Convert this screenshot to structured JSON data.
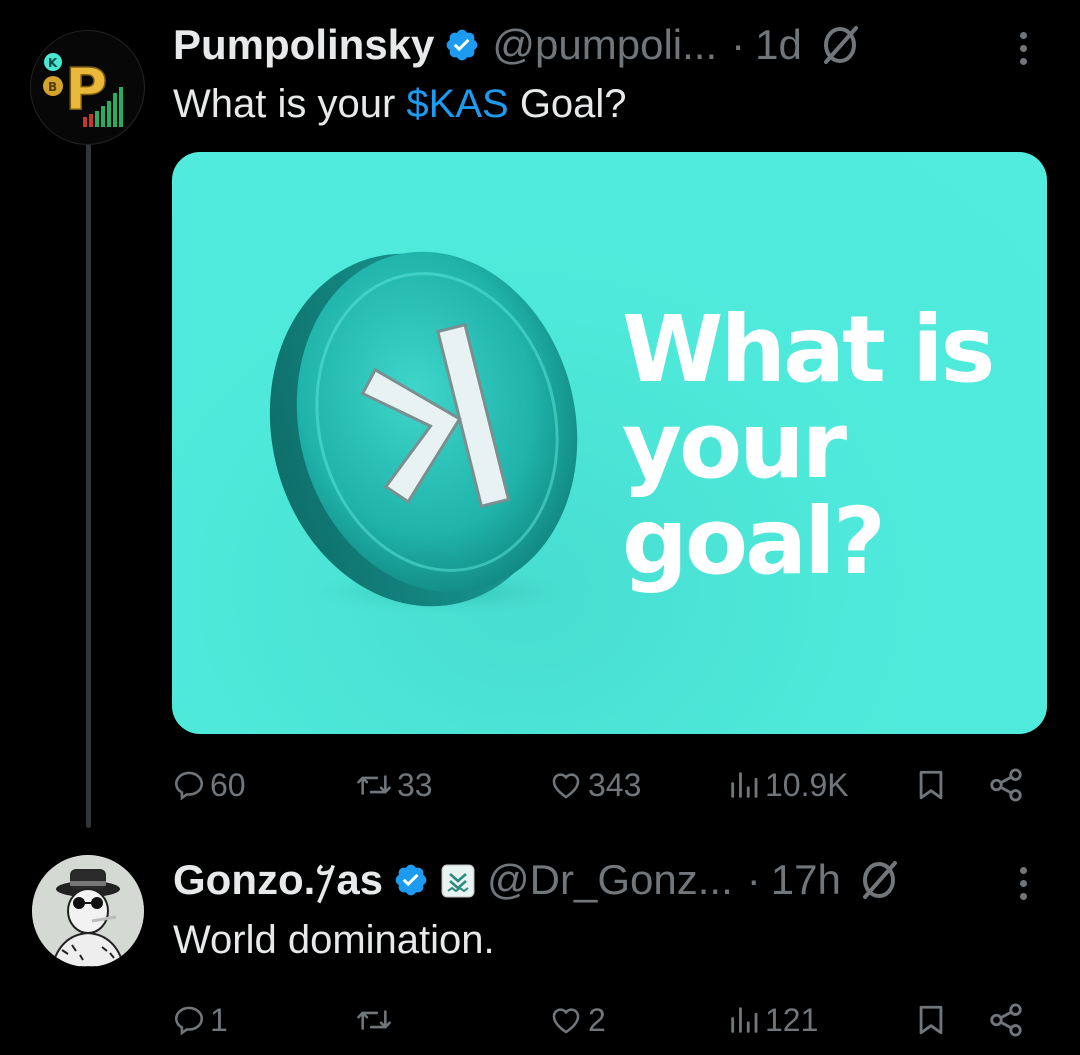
{
  "tweets": [
    {
      "author_name": "Pumpolinsky",
      "handle": "@pumpoli...",
      "separator": "·",
      "time": "1d",
      "text_before": "What is your ",
      "cashtag": "$KAS",
      "text_after": " Goal?",
      "media": {
        "text_lines": [
          "What is",
          "your",
          "goal?"
        ],
        "coin_symbol": "K"
      },
      "stats": {
        "replies": "60",
        "reposts": "33",
        "likes": "343",
        "views": "10.9K"
      }
    },
    {
      "author_name": "Gonzo.𐤊as",
      "handle": "@Dr_Gonz...",
      "separator": "·",
      "time": "17h",
      "text": "World domination.",
      "stats": {
        "replies": "1",
        "reposts": "",
        "likes": "2",
        "views": "121"
      }
    }
  ],
  "colors": {
    "background": "#000000",
    "text": "#e7e9ea",
    "secondary": "#71767b",
    "link": "#1d9bf0",
    "verified": "#1d9bf0",
    "media_bg": "#4ee9da"
  },
  "icons": [
    "verified-badge-icon",
    "grok-icon",
    "more-icon",
    "reply-icon",
    "repost-icon",
    "like-icon",
    "views-icon",
    "bookmark-icon",
    "share-icon"
  ]
}
